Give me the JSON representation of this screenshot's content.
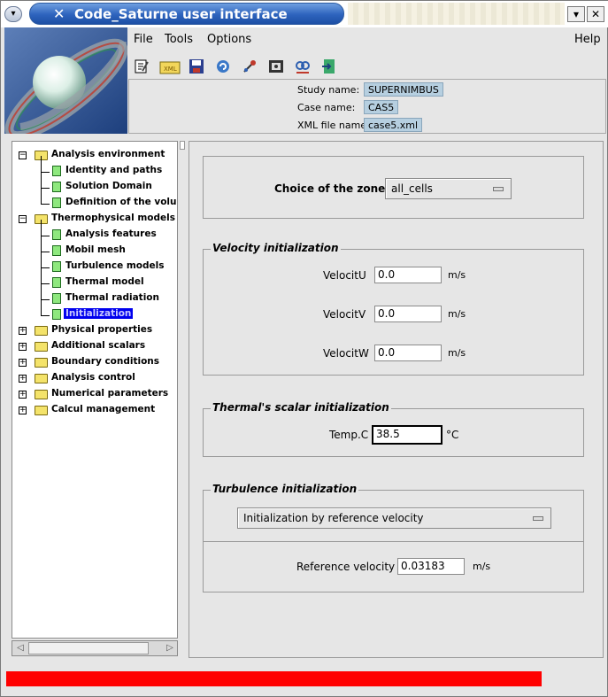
{
  "window": {
    "title": "Code_Saturne user interface",
    "menu_button_icon": "chevron-down-icon",
    "minimize_icon": "chevron-down-icon",
    "close_icon": "close-icon"
  },
  "menubar": {
    "file": "File",
    "tools": "Tools",
    "options": "Options",
    "help": "Help"
  },
  "toolbar": {
    "icons": [
      "new-file-icon",
      "open-xml-icon",
      "save-icon",
      "refresh-icon",
      "satellite-icon",
      "run-icon",
      "identity-icon",
      "exit-icon"
    ],
    "xml_label": "XML"
  },
  "study": {
    "study_label": "Study name:",
    "study_value": "SUPERNIMBUS",
    "case_label": "Case name:",
    "case_value": "CAS5",
    "xml_label": "XML file name:",
    "xml_value": "case5.xml"
  },
  "tree": {
    "nodes": [
      {
        "label": "Analysis environment",
        "level": 0,
        "expanded": true
      },
      {
        "label": "Identity and paths",
        "level": 1
      },
      {
        "label": "Solution Domain",
        "level": 1
      },
      {
        "label": "Definition of the volumi",
        "level": 1
      },
      {
        "label": "Thermophysical models",
        "level": 0,
        "expanded": true
      },
      {
        "label": "Analysis features",
        "level": 1
      },
      {
        "label": "Mobil mesh",
        "level": 1
      },
      {
        "label": "Turbulence models",
        "level": 1
      },
      {
        "label": "Thermal model",
        "level": 1
      },
      {
        "label": "Thermal radiation",
        "level": 1
      },
      {
        "label": "Initialization",
        "level": 1,
        "selected": true
      },
      {
        "label": "Physical properties",
        "level": 0,
        "expanded": false
      },
      {
        "label": "Additional scalars",
        "level": 0,
        "expanded": false
      },
      {
        "label": "Boundary conditions",
        "level": 0,
        "expanded": false
      },
      {
        "label": "Analysis control",
        "level": 0,
        "expanded": false
      },
      {
        "label": "Numerical parameters",
        "level": 0,
        "expanded": false
      },
      {
        "label": "Calcul management",
        "level": 0,
        "expanded": false
      }
    ],
    "expand_symbol": "+",
    "collapse_symbol": "−"
  },
  "zone": {
    "label": "Choice of the zone",
    "value": "all_cells"
  },
  "velocity": {
    "title": "Velocity initialization",
    "u_label": "VelocitU",
    "u_value": "0.0",
    "v_label": "VelocitV",
    "v_value": "0.0",
    "w_label": "VelocitW",
    "w_value": "0.0",
    "unit": "m/s"
  },
  "thermal": {
    "title": "Thermal's scalar initialization",
    "label": "Temp.C",
    "value": "38.5",
    "unit": "°C"
  },
  "turbulence": {
    "title": "Turbulence initialization",
    "mode": "Initialization by reference velocity",
    "ref_label": "Reference velocity",
    "ref_value": "0.03183",
    "unit": "m/s"
  },
  "status": {
    "progress_fraction": 0.88,
    "progress_color": "#ff0000"
  }
}
